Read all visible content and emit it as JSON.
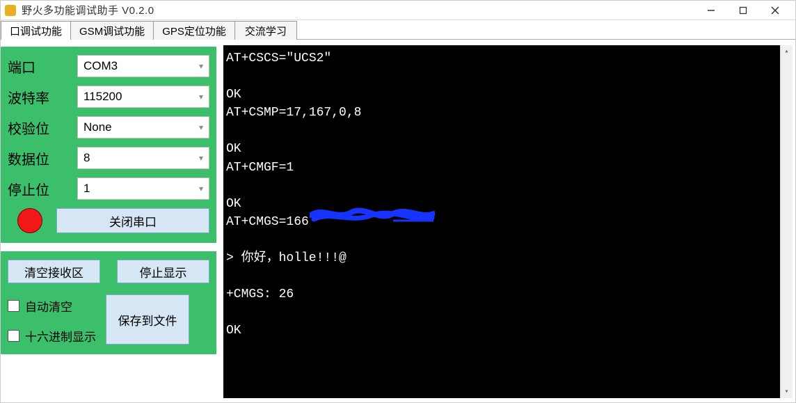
{
  "window": {
    "title": "野火多功能调试助手 V0.2.0"
  },
  "tabs": [
    {
      "label": "口调试功能",
      "active": true
    },
    {
      "label": "GSM调试功能",
      "active": false
    },
    {
      "label": "GPS定位功能",
      "active": false
    },
    {
      "label": "交流学习",
      "active": false
    }
  ],
  "serial_panel": {
    "port": {
      "label": "端口",
      "value": "COM3"
    },
    "baud": {
      "label": "波特率",
      "value": "115200"
    },
    "parity": {
      "label": "校验位",
      "value": "None"
    },
    "databits": {
      "label": "数据位",
      "value": "8"
    },
    "stopbits": {
      "label": "停止位",
      "value": "1"
    },
    "close_port_btn": "关闭串口"
  },
  "receive_panel": {
    "clear_btn": "清空接收区",
    "stop_btn": "停止显示",
    "auto_clear": "自动清空",
    "hex_display": "十六进制显示",
    "save_btn": "保存到文件"
  },
  "terminal_lines": [
    "AT+CSCS=\"UCS2\"",
    "",
    "OK",
    "AT+CSMP=17,167,0,8",
    "",
    "OK",
    "AT+CMGF=1",
    "",
    "OK",
    "AT+CMGS=166",
    "",
    "> 你好，holle!!!@",
    "",
    "+CMGS: 26",
    "",
    "OK"
  ]
}
